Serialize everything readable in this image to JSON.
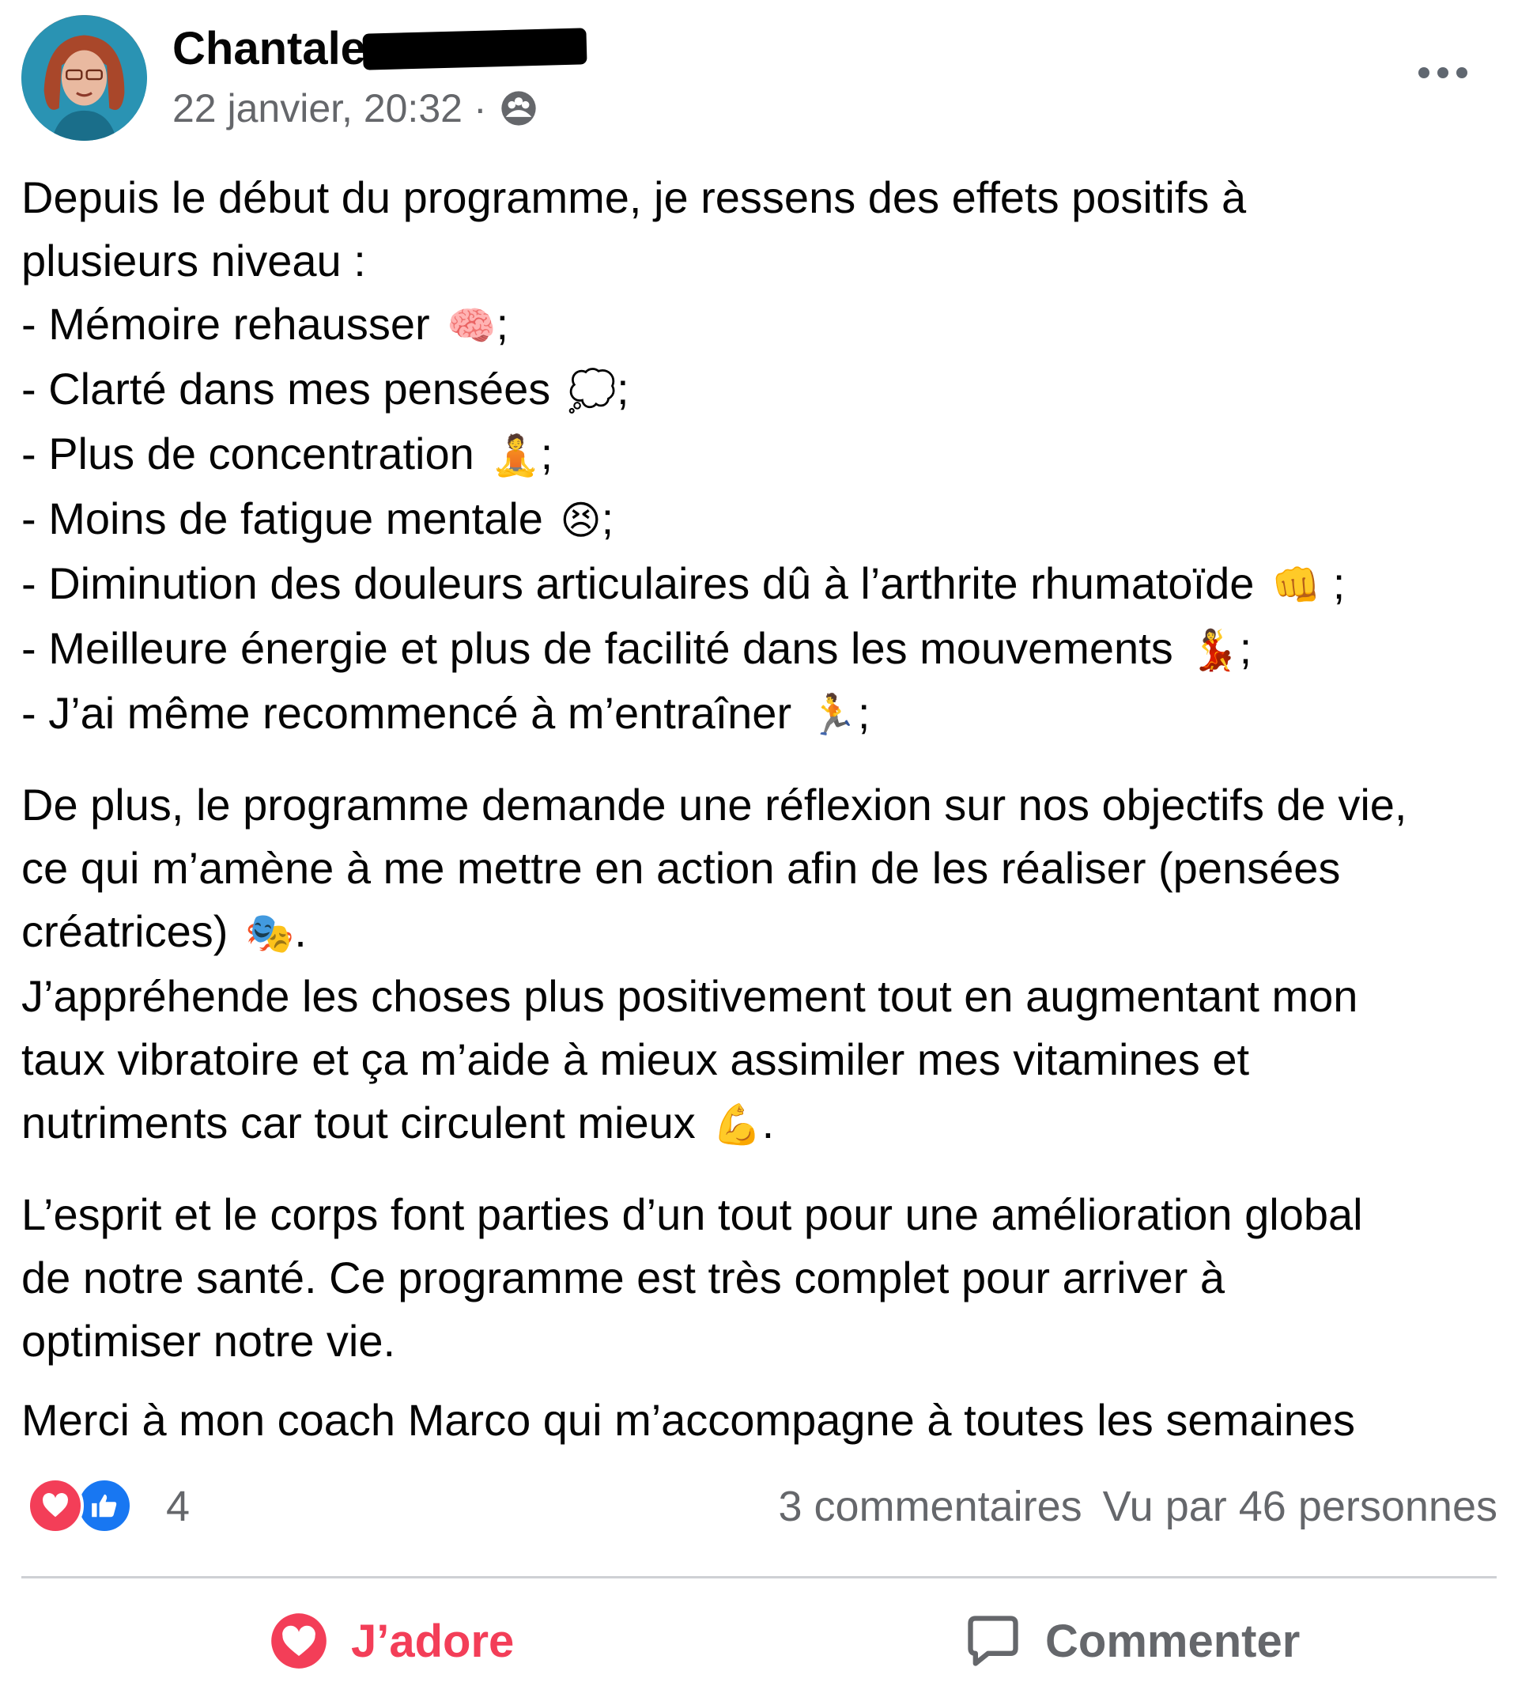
{
  "post": {
    "author_name": "Chantale",
    "timestamp": "22 janvier, 20:32",
    "meta_separator": "·",
    "audience_icon": "group-audience-icon",
    "more_icon": "more-options-icon"
  },
  "body": {
    "intro_lines": [
      "Depuis le début du programme, je ressens des effets positifs à",
      "plusieurs niveau :"
    ],
    "benefits": [
      {
        "text": "- Mémoire rehausser",
        "emoji": "🧠",
        "suffix": ";"
      },
      {
        "text": "- Clarté dans mes pensées",
        "emoji": "💭",
        "suffix": ";"
      },
      {
        "text": "- Plus de concentration",
        "emoji": "🧘",
        "suffix": ";"
      },
      {
        "text": "- Moins de fatigue mentale",
        "emoji": "😣",
        "suffix": ";"
      },
      {
        "text": "- Diminution des douleurs articulaires dû à l’arthrite rhumatoïde",
        "emoji": "👊",
        "suffix": " ;"
      },
      {
        "text": "- Meilleure énergie et plus de facilité dans les mouvements",
        "emoji": "💃",
        "suffix": ";"
      },
      {
        "text": "- J’ai même recommencé à m’entraîner",
        "emoji": "🏃",
        "suffix": ";"
      }
    ],
    "para2_lines": [
      "De plus, le programme demande une réflexion sur nos objectifs de vie,",
      "ce qui m’amène à me mettre en action afin de les réaliser (pensées"
    ],
    "para2_last": {
      "text": "créatrices)",
      "emoji": "🎭",
      "suffix": "."
    },
    "para3_lines": [
      "J’appréhende les choses plus positivement tout en augmentant mon",
      "taux vibratoire et ça m’aide à mieux assimiler mes vitamines et"
    ],
    "para3_last": {
      "text": "nutriments car tout circulent mieux",
      "emoji": "💪",
      "suffix": "."
    },
    "para4_lines": [
      "L’esprit et le corps font parties d’un tout pour une amélioration global",
      "de notre santé. Ce programme est très complet pour arriver à",
      "optimiser notre vie."
    ],
    "para5_lines": [
      "Merci à mon coach Marco qui m’accompagne à toutes les semaines"
    ]
  },
  "reactions": {
    "icons": [
      "love-reaction-icon",
      "like-reaction-icon"
    ],
    "count": "4",
    "comments": "3 commentaires",
    "views": "Vu par 46 personnes"
  },
  "actions": {
    "love_label": "J’adore",
    "comment_label": "Commenter"
  },
  "colors": {
    "love": "#f33e58",
    "like": "#1877f2",
    "secondary_text": "#65676b"
  }
}
